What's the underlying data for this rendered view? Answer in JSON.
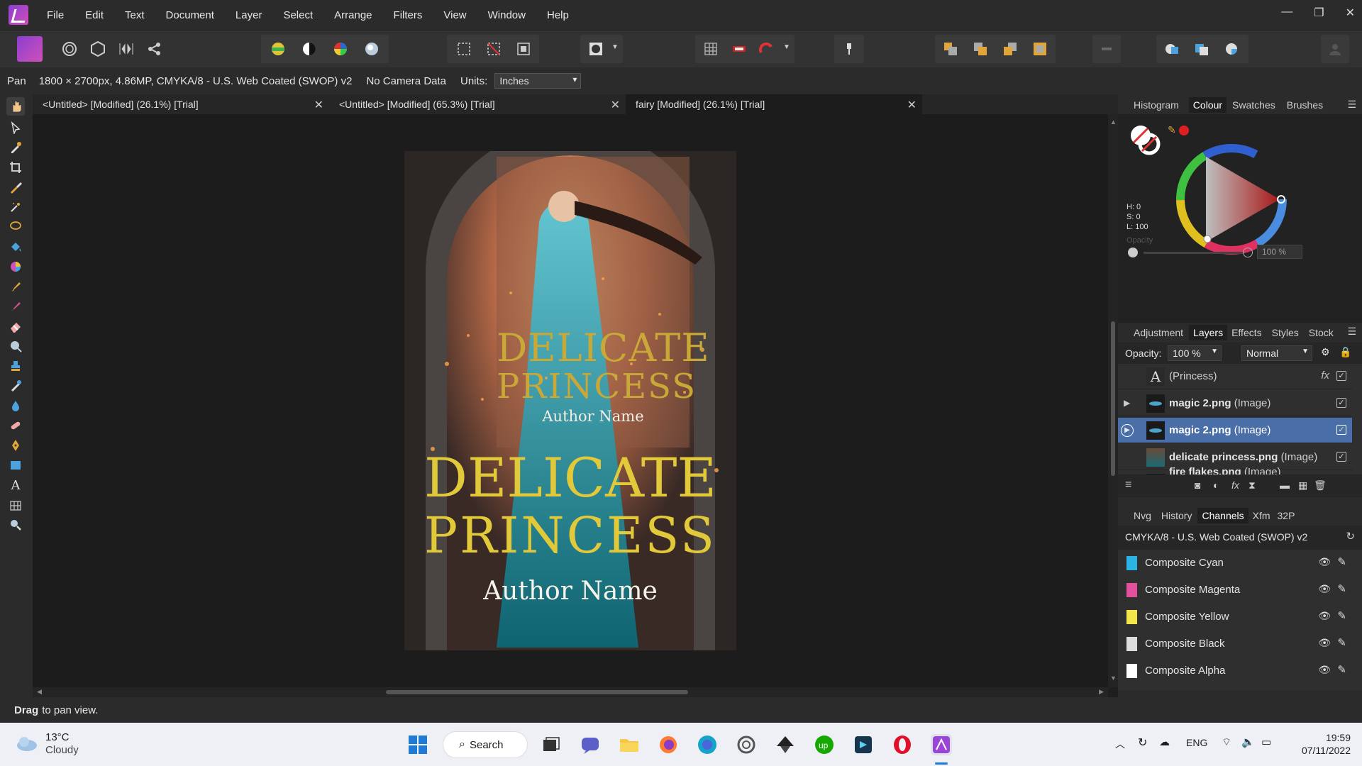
{
  "menubar": {
    "items": [
      "File",
      "Edit",
      "Text",
      "Document",
      "Layer",
      "Select",
      "Arrange",
      "Filters",
      "View",
      "Window",
      "Help"
    ]
  },
  "context": {
    "tool": "Pan",
    "doc_info": "1800 × 2700px, 4.86MP, CMYKA/8 - U.S. Web Coated (SWOP) v2",
    "camera": "No Camera Data",
    "units_label": "Units:",
    "units_value": "Inches"
  },
  "tabs": [
    {
      "label": "<Untitled> [Modified] (26.1%) [Trial]"
    },
    {
      "label": "<Untitled> [Modified] (65.3%) [Trial]"
    },
    {
      "label": "fairy [Modified] (26.1%) [Trial]"
    }
  ],
  "cover": {
    "title_small_line1": "DELICATE",
    "title_small_line2": "PRINCESS",
    "author_small": "Author Name",
    "title_large_line1": "DELICATE",
    "title_large_line2": "PRINCESS",
    "author_large": "Author Name"
  },
  "status": {
    "bold": "Drag",
    "rest": "to pan view."
  },
  "colour_panel": {
    "tabs": [
      "Histogram",
      "Colour",
      "Swatches",
      "Brushes"
    ],
    "h": "H: 0",
    "s": "S: 0",
    "l": "L: 100",
    "opacity_label": "Opacity",
    "opacity_value": "100 %"
  },
  "layers_panel": {
    "tabs": [
      "Adjustment",
      "Layers",
      "Effects",
      "Styles",
      "Stock"
    ],
    "opacity_label": "Opacity:",
    "opacity_value": "100 %",
    "blend_mode": "Normal",
    "layers": [
      {
        "name": "",
        "type": "(Princess)",
        "fx": "fx"
      },
      {
        "name": "magic 2.png",
        "type": "(Image)"
      },
      {
        "name": "magic 2.png",
        "type": "(Image)"
      },
      {
        "name": "delicate princess.png",
        "type": "(Image)"
      },
      {
        "name": "fire flakes.png",
        "type": "(Image)"
      }
    ]
  },
  "channels_panel": {
    "tabs": [
      "Nvg",
      "History",
      "Channels",
      "Xfm",
      "32P"
    ],
    "profile": "CMYKA/8 - U.S. Web Coated (SWOP) v2",
    "channels": [
      {
        "name": "Composite Cyan",
        "color": "#2bb3e6"
      },
      {
        "name": "Composite Magenta",
        "color": "#e0509c"
      },
      {
        "name": "Composite Yellow",
        "color": "#f2e64a"
      },
      {
        "name": "Composite Black",
        "color": "#dddddd"
      },
      {
        "name": "Composite Alpha",
        "color": "#ffffff"
      }
    ]
  },
  "taskbar": {
    "temp": "13°C",
    "weather": "Cloudy",
    "search": "Search",
    "lang": "ENG",
    "time": "19:59",
    "date": "07/11/2022"
  }
}
